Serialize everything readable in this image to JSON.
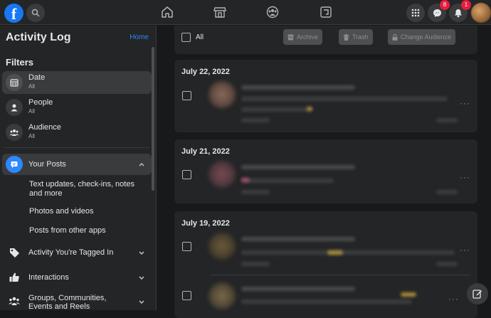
{
  "topbar": {
    "logo": "f",
    "messenger_badge": "8",
    "notifications_badge": "1"
  },
  "sidebar": {
    "title": "Activity Log",
    "home_link": "Home",
    "filters_heading": "Filters",
    "filters": [
      {
        "label": "Date",
        "sub": "All"
      },
      {
        "label": "People",
        "sub": "All"
      },
      {
        "label": "Audience",
        "sub": "All"
      }
    ],
    "your_posts": {
      "label": "Your Posts",
      "sub_items": [
        "Text updates, check-ins, notes and more",
        "Photos and videos",
        "Posts from other apps"
      ]
    },
    "sections": [
      "Activity You're Tagged In",
      "Interactions",
      "Groups, Communities, Events and Reels"
    ]
  },
  "toolbar": {
    "all_label": "All",
    "archive_label": "Archive",
    "trash_label": "Trash",
    "change_audience_label": "Change Audience"
  },
  "cards": [
    {
      "date": "July 22, 2022"
    },
    {
      "date": "July 21, 2022"
    },
    {
      "date": "July 19, 2022"
    }
  ],
  "icons": {
    "home": "home-icon",
    "marketplace": "store-icon",
    "groups": "groups-icon",
    "gaming": "gaming-icon",
    "menu": "grid-icon",
    "messenger": "messenger-icon",
    "notifications": "bell-icon",
    "compose": "compose-icon"
  },
  "colors": {
    "accent": "#1877f2",
    "badge": "#e41e3f",
    "background": "#18191a",
    "surface": "#242526"
  }
}
